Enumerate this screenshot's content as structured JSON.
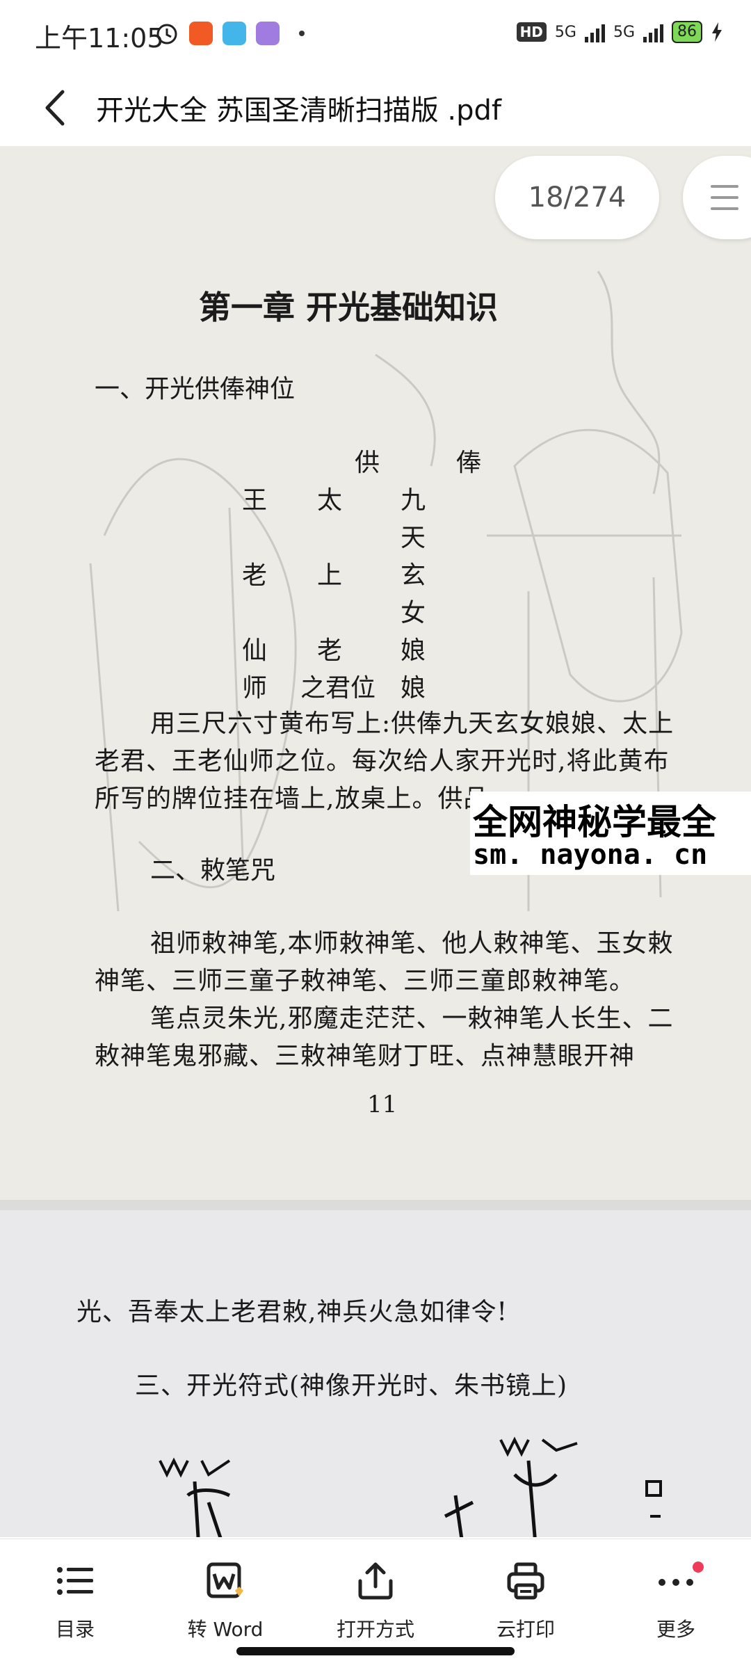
{
  "status_bar": {
    "time": "上午11:05",
    "hd_badge": "HD",
    "net1": "5G",
    "net2": "5G",
    "battery": "86"
  },
  "header": {
    "title": "开光大全  苏国圣清晰扫描版 .pdf"
  },
  "page_indicator": "18/274",
  "document": {
    "page1": {
      "chapter_title": "第一章    开光基础知识",
      "section1_title": "一、开光供俸神位",
      "offering_header": [
        "供",
        "俸"
      ],
      "offering_rows": [
        [
          "王",
          "太",
          "九"
        ],
        [
          "",
          "",
          "天"
        ],
        [
          "老",
          "上",
          "玄"
        ],
        [
          "",
          "",
          "女"
        ],
        [
          "仙",
          "老",
          "娘"
        ],
        [
          "师",
          "之君位",
          "娘"
        ]
      ],
      "para1": "用三尺六寸黄布写上:供俸九天玄女娘娘、太上老君、王老仙师之位。每次给人家开光时,将此黄布所写的牌位挂在墙上,放桌上。供品",
      "section2_title": "二、敕笔咒",
      "para2": "祖师敕神笔,本师敕神笔、他人敕神笔、玉女敕神笔、三师三童子敕神笔、三师三童郎敕神笔。",
      "para3": "笔点灵朱光,邪魔走茫茫、一敕神笔人长生、二敕神笔鬼邪藏、三敕神笔财丁旺、点神慧眼开神",
      "page_number": "11"
    },
    "page2": {
      "line1": "光、吾奉太上老君敕,神兵火急如律令!",
      "section3_title": "三、开光符式(神像开光时、朱书镜上)"
    }
  },
  "watermark": {
    "line1": "全网神秘学最全",
    "line2": "sm. nayona. cn"
  },
  "bottom_nav": [
    {
      "label": "目录",
      "icon": "list-icon"
    },
    {
      "label": "转 Word",
      "icon": "word-convert-icon"
    },
    {
      "label": "打开方式",
      "icon": "share-icon"
    },
    {
      "label": "云打印",
      "icon": "printer-icon"
    },
    {
      "label": "更多",
      "icon": "more-icon"
    }
  ],
  "colors": {
    "page_bg": "#ecebe5",
    "notification_dot": "#ef3b5a",
    "battery_fill": "#7ed957"
  }
}
